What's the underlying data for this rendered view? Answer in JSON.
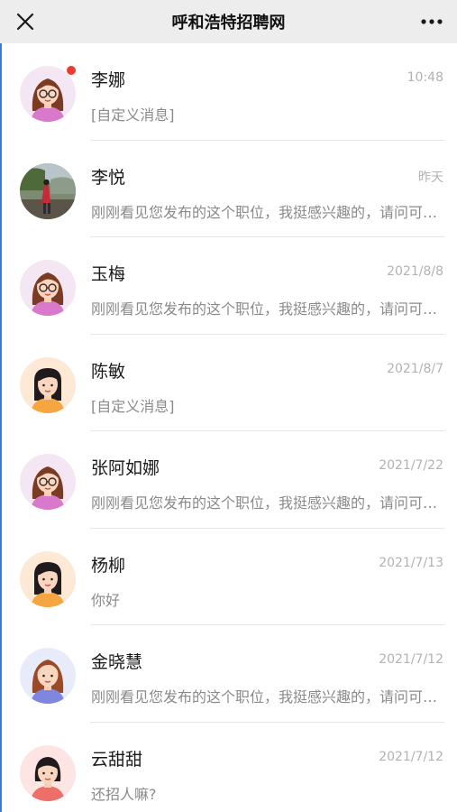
{
  "header": {
    "title": "呼和浩特招聘网",
    "close_icon": "close-icon",
    "more_icon": "more-horizontal-icon",
    "background": "#ededed"
  },
  "accent_colors": {
    "unread": "#ee3b2f",
    "time": "#b2b2b2",
    "preview": "#8a8a8a"
  },
  "conversations": [
    {
      "name": "李娜",
      "time": "10:48",
      "preview": "[自定义消息]",
      "unread": true,
      "avatar": "woman-glasses-avatar"
    },
    {
      "name": "李悦",
      "time": "昨天",
      "preview": "刚刚看见您发布的这个职位，我挺感兴趣的，请问可以详细聊聊吗？",
      "unread": false,
      "avatar": "photo-avatar"
    },
    {
      "name": "玉梅",
      "time": "2021/8/8",
      "preview": "刚刚看见您发布的这个职位，我挺感兴趣的，请问可以详细聊聊吗？",
      "unread": false,
      "avatar": "woman-glasses-avatar"
    },
    {
      "name": "陈敏",
      "time": "2021/8/7",
      "preview": "[自定义消息]",
      "unread": false,
      "avatar": "woman-straight-hair-avatar"
    },
    {
      "name": "张阿如娜",
      "time": "2021/7/22",
      "preview": "刚刚看见您发布的这个职位，我挺感兴趣的，请问可以详细聊聊吗？",
      "unread": false,
      "avatar": "woman-glasses-avatar"
    },
    {
      "name": "杨柳",
      "time": "2021/7/13",
      "preview": "你好",
      "unread": false,
      "avatar": "woman-straight-hair-avatar"
    },
    {
      "name": "金晓慧",
      "time": "2021/7/12",
      "preview": "刚刚看见您发布的这个职位，我挺感兴趣的，请问可以详细聊聊吗？",
      "unread": false,
      "avatar": "woman-brown-hair-avatar"
    },
    {
      "name": "云甜甜",
      "time": "2021/7/12",
      "preview": "还招人嘛?",
      "unread": false,
      "avatar": "woman-short-hair-avatar"
    }
  ]
}
